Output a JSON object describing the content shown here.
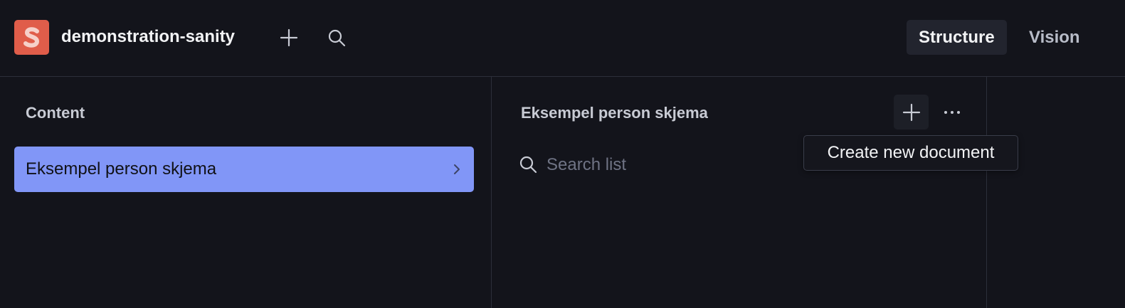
{
  "header": {
    "logo_letter": "S",
    "project_name": "demonstration-sanity",
    "icons": {
      "add": "plus-icon",
      "search": "search-icon"
    },
    "tools": [
      {
        "label": "Structure",
        "active": true
      },
      {
        "label": "Vision",
        "active": false
      }
    ]
  },
  "content_pane": {
    "title": "Content",
    "items": [
      {
        "label": "Eksempel person skjema",
        "selected": true,
        "icon": "chevron-right-icon"
      }
    ]
  },
  "list_pane": {
    "title": "Eksempel person skjema",
    "actions": {
      "add": "plus-icon",
      "menu": "ellipsis-icon"
    },
    "search": {
      "placeholder": "Search list",
      "value": ""
    }
  },
  "tooltip": {
    "text": "Create new document"
  },
  "colors": {
    "background": "#13141b",
    "logo": "#e05d4a",
    "selected_item": "#8196f7",
    "border": "#2c2f3a"
  }
}
